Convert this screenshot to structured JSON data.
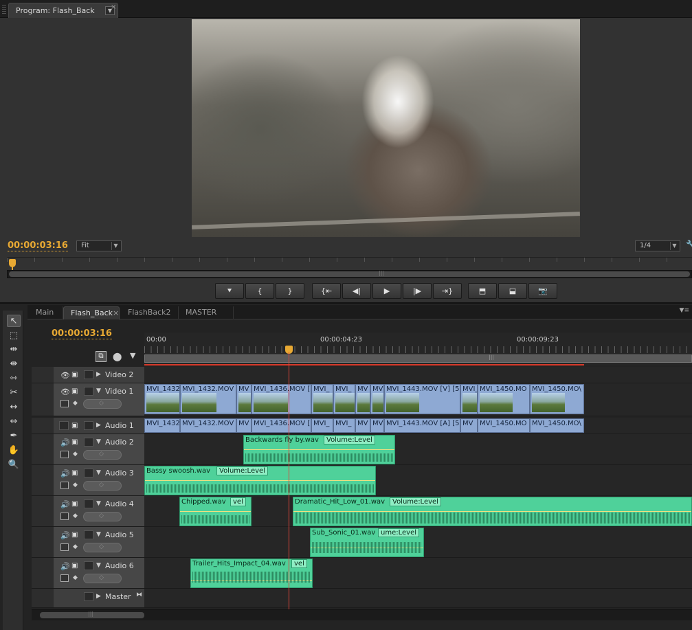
{
  "program": {
    "tab_label": "Program: Flash_Back",
    "tab_menu_icon": "chevron-down-icon",
    "close_glyph": "×",
    "timecode": "00:00:03:16",
    "fit_value": "Fit",
    "resolution_value": "1/4",
    "transport": {
      "add_marker": "⯆",
      "mark_in": "{",
      "mark_out": "}",
      "go_to_in": "{⇤",
      "step_back": "◀|",
      "play": "▶",
      "step_forward": "|▶",
      "go_to_out": "⇥}",
      "lift": "⬒",
      "extract": "⬓",
      "export_frame": "📷"
    }
  },
  "tools": [
    {
      "icon": "selection-tool-icon",
      "glyph": "↖"
    },
    {
      "icon": "track-select-tool-icon",
      "glyph": "⬚"
    },
    {
      "icon": "ripple-edit-tool-icon",
      "glyph": "⇹"
    },
    {
      "icon": "rolling-edit-tool-icon",
      "glyph": "⇼"
    },
    {
      "icon": "rate-stretch-tool-icon",
      "glyph": "⇿"
    },
    {
      "icon": "razor-tool-icon",
      "glyph": "✂"
    },
    {
      "icon": "slip-tool-icon",
      "glyph": "↔"
    },
    {
      "icon": "slide-tool-icon",
      "glyph": "⇔"
    },
    {
      "icon": "pen-tool-icon",
      "glyph": "✒"
    },
    {
      "icon": "hand-tool-icon",
      "glyph": "✋"
    },
    {
      "icon": "zoom-tool-icon",
      "glyph": "🔍"
    }
  ],
  "sequence_tabs": [
    "Main",
    "Flash_Back",
    "FlashBack2",
    "MASTER"
  ],
  "active_tab_close": "×",
  "sequence": {
    "timecode": "00:00:03:16",
    "ruler": [
      "00:00",
      "00:00:04:23",
      "00:00:09:23"
    ]
  },
  "tracks": {
    "video2": "Video 2",
    "video1": "Video 1",
    "audio1": "Audio 1",
    "audio2": "Audio 2",
    "audio3": "Audio 3",
    "audio4": "Audio 4",
    "audio5": "Audio 5",
    "audio6": "Audio 6",
    "master": "Master"
  },
  "video1_clips": [
    "MVI_1432",
    "MVI_1432.MOV",
    "MV",
    "MVI_1436.MOV [",
    "MVI_",
    "MVI_",
    "MV",
    "MV",
    "MVI_1443.MOV [V] [5",
    "MVI_",
    "MVI_1450.MO",
    "MVI_1450.MO\\"
  ],
  "audio1_clips": [
    "MVI_1432",
    "MVI_1432.MOV",
    "MV",
    "MVI_1436.MOV [",
    "MVI_",
    "MVI_",
    "MV",
    "MV",
    "MVI_1443.MOV [A] [5",
    "MV",
    "MVI_1450.MO",
    "MVI_1450.MO\\"
  ],
  "audio_clips": {
    "a2": {
      "name": "Backwards fly by.wav",
      "effect": "Volume:Level"
    },
    "a3": {
      "name": "Bassy swoosh.wav",
      "effect": "Volume:Level"
    },
    "a4a": {
      "name": "Chipped.wav",
      "effect": "vel"
    },
    "a4b": {
      "name": "Dramatic_Hit_Low_01.wav",
      "effect": "Volume:Level"
    },
    "a5": {
      "name": "Sub_Sonic_01.wav",
      "effect": "ume:Level"
    },
    "a6": {
      "name": "Trailer_Hits_Impact_04.wav",
      "effect": "vel"
    }
  },
  "colors": {
    "timecode": "#e8a933",
    "video_clip": "#8ea9d3",
    "audio_clip": "#4fd19a",
    "playhead": "#e0443a"
  }
}
